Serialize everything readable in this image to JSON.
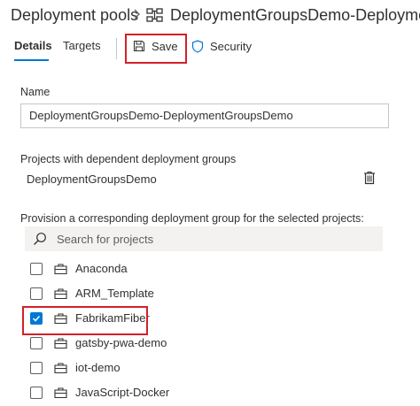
{
  "header": {
    "root": "Deployment pools",
    "title": "DeploymentGroupsDemo-Deployment..."
  },
  "tabs": [
    {
      "label": "Details",
      "selected": true
    },
    {
      "label": "Targets",
      "selected": false
    }
  ],
  "toolbar": {
    "save_label": "Save",
    "security_label": "Security"
  },
  "form": {
    "name_label": "Name",
    "name_value": "DeploymentGroupsDemo-DeploymentGroupsDemo",
    "dependent_label": "Projects with dependent deployment groups",
    "dependent_value": "DeploymentGroupsDemo",
    "provision_label": "Provision a corresponding deployment group for the selected projects:",
    "search_placeholder": "Search for projects"
  },
  "projects": [
    {
      "name": "Anaconda",
      "checked": false
    },
    {
      "name": "ARM_Template",
      "checked": false
    },
    {
      "name": "FabrikamFiber",
      "checked": true
    },
    {
      "name": "gatsby-pwa-demo",
      "checked": false
    },
    {
      "name": "iot-demo",
      "checked": false
    },
    {
      "name": "JavaScript-Docker",
      "checked": false
    }
  ],
  "colors": {
    "accent": "#0078d4",
    "highlight": "#d32028"
  }
}
